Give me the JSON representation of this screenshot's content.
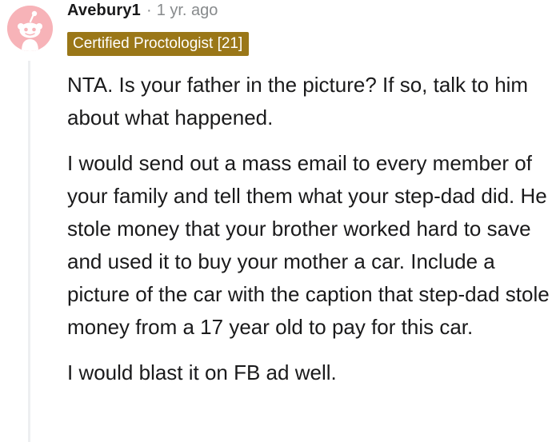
{
  "comment": {
    "author": "Avebury1",
    "separator": "·",
    "age": "1 yr. ago",
    "flair": "Certified Proctologist [21]",
    "paragraphs": [
      "NTA. Is your father in the picture? If so, talk to him about what happened.",
      "I would send out a mass email to every member of your family and tell them what your step-dad did. He stole money that your brother worked hard to save and used it to buy your mother a car. Include a picture of the car with the caption that step-dad stole money from a 17 year old to pay for this car.",
      "I would blast it on FB ad well."
    ]
  },
  "colors": {
    "avatar_bg": "#f7b3b8",
    "flair_bg": "#9a7718",
    "meta_text": "#878a8c",
    "thread_line": "#edeff1"
  },
  "icons": {
    "avatar": "reddit-snoo-avatar-icon"
  }
}
